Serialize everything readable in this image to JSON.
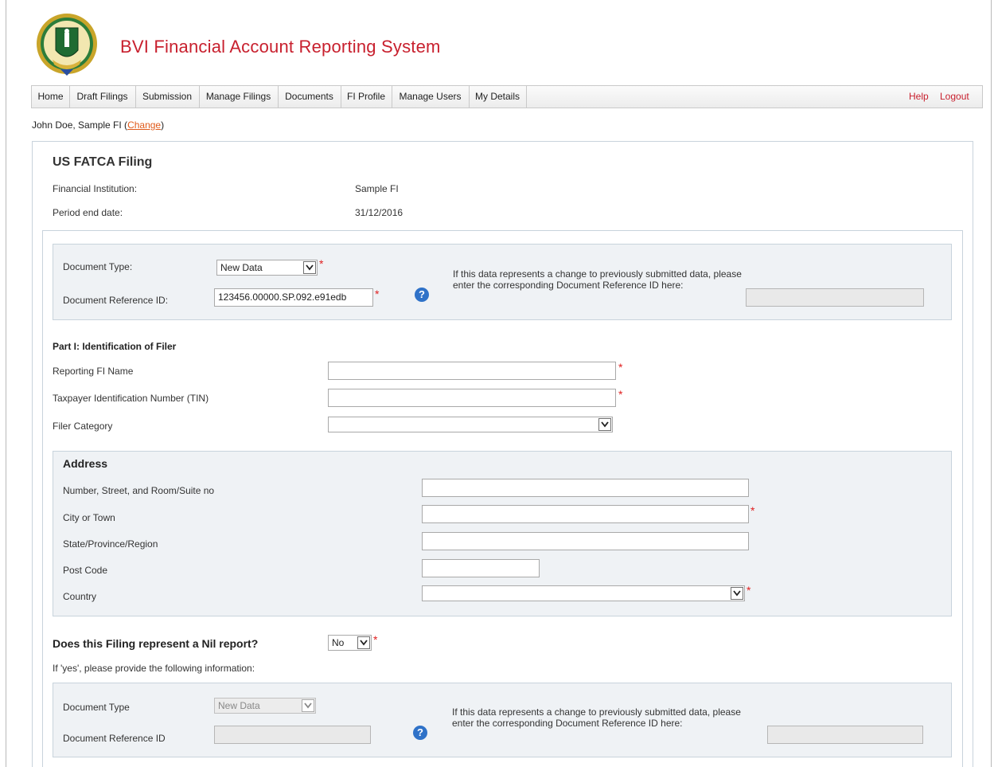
{
  "header": {
    "title": "BVI Financial Account Reporting System"
  },
  "nav": {
    "items": [
      "Home",
      "Draft Filings",
      "Submission",
      "Manage Filings",
      "Documents",
      "FI Profile",
      "Manage Users",
      "My Details"
    ],
    "help": "Help",
    "logout": "Logout"
  },
  "user": {
    "text": "John Doe, Sample FI (",
    "change": "Change",
    "close": ")"
  },
  "filing": {
    "title": "US FATCA Filing",
    "fi_label": "Financial Institution:",
    "fi_value": "Sample FI",
    "period_label": "Period end date:",
    "period_value": "31/12/2016"
  },
  "doc": {
    "type_label": "Document Type:",
    "type_value": "New Data",
    "ref_label": "Document Reference ID:",
    "ref_value": "123456.00000.SP.092.e91edb",
    "correction_text": "If this data represents a change to previously submitted data, please enter the corresponding Document Reference ID here:",
    "correction_value": ""
  },
  "part1": {
    "title": "Part I: Identification of Filer",
    "fi_name_label": "Reporting FI Name",
    "fi_name_value": "",
    "tin_label": "Taxpayer Identification Number (TIN)",
    "tin_value": "",
    "category_label": "Filer Category",
    "category_value": ""
  },
  "address": {
    "title": "Address",
    "street_label": "Number, Street, and Room/Suite no",
    "city_label": "City or Town",
    "state_label": "State/Province/Region",
    "postcode_label": "Post Code",
    "country_label": "Country",
    "street_value": "",
    "city_value": "",
    "state_value": "",
    "postcode_value": "",
    "country_value": ""
  },
  "nil": {
    "question": "Does this Filing represent a Nil report?",
    "value": "No",
    "hint": "If 'yes', please provide the following information:",
    "doc_type_label": "Document Type",
    "doc_type_value": "New Data",
    "doc_ref_label": "Document Reference ID",
    "doc_ref_value": "",
    "correction_text": "If this data represents a change to previously submitted data, please enter the corresponding Document Reference ID here:",
    "correction_value": ""
  },
  "required_marker": "*",
  "colors": {
    "brand_red": "#c8202e",
    "help_blue": "#2f72c8",
    "link_orange": "#e05a1a"
  }
}
